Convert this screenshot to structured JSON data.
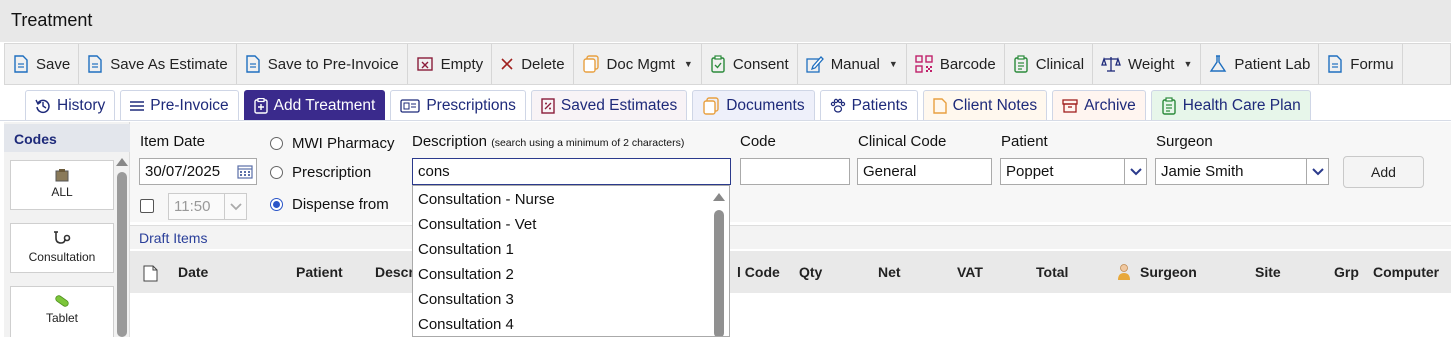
{
  "window": {
    "title": "Treatment"
  },
  "toolbar": [
    {
      "name": "save-button",
      "icon": "document-icon",
      "label": "Save",
      "caret": false
    },
    {
      "name": "save-as-estimate-button",
      "icon": "document-icon",
      "label": "Save As Estimate",
      "caret": false
    },
    {
      "name": "save-to-pre-invoice-button",
      "icon": "document-icon",
      "label": "Save to Pre-Invoice",
      "caret": false
    },
    {
      "name": "empty-button",
      "icon": "empty-box-icon",
      "label": "Empty",
      "caret": false
    },
    {
      "name": "delete-button",
      "icon": "close-icon",
      "label": "Delete",
      "caret": false
    },
    {
      "name": "doc-mgmt-button",
      "icon": "documents-icon",
      "label": "Doc Mgmt",
      "caret": true
    },
    {
      "name": "consent-button",
      "icon": "clipboard-check-icon",
      "label": "Consent",
      "caret": false
    },
    {
      "name": "manual-button",
      "icon": "pencil-icon",
      "label": "Manual",
      "caret": true
    },
    {
      "name": "barcode-button",
      "icon": "qr-code-icon",
      "label": "Barcode",
      "caret": false
    },
    {
      "name": "clinical-button",
      "icon": "clipboard-icon",
      "label": "Clinical",
      "caret": false
    },
    {
      "name": "weight-button",
      "icon": "scales-icon",
      "label": "Weight",
      "caret": true
    },
    {
      "name": "patient-lab-button",
      "icon": "flask-icon",
      "label": "Patient Lab",
      "caret": false
    },
    {
      "name": "formulary-button",
      "icon": "document-icon",
      "label": "Formu",
      "caret": false
    }
  ],
  "tabs": [
    {
      "name": "tab-history",
      "icon": "history-icon",
      "label": "History",
      "variant": ""
    },
    {
      "name": "tab-pre-invoice",
      "icon": "list-icon",
      "label": "Pre-Invoice",
      "variant": ""
    },
    {
      "name": "tab-add-treatment",
      "icon": "clipboard-plus-icon",
      "label": "Add Treatment",
      "variant": "active"
    },
    {
      "name": "tab-prescriptions",
      "icon": "prescription-icon",
      "label": "Prescriptions",
      "variant": ""
    },
    {
      "name": "tab-saved-estimates",
      "icon": "estimate-icon",
      "label": "Saved Estimates",
      "variant": "saved"
    },
    {
      "name": "tab-documents",
      "icon": "documents-icon",
      "label": "Documents",
      "variant": "docs"
    },
    {
      "name": "tab-patients",
      "icon": "paw-icon",
      "label": "Patients",
      "variant": ""
    },
    {
      "name": "tab-client-notes",
      "icon": "note-icon",
      "label": "Client Notes",
      "variant": "notes"
    },
    {
      "name": "tab-archive",
      "icon": "archive-icon",
      "label": "Archive",
      "variant": "archive"
    },
    {
      "name": "tab-health-care-plan",
      "icon": "clipboard-icon",
      "label": "Health Care Plan",
      "variant": "hcp"
    }
  ],
  "codes": {
    "heading": "Codes",
    "items": [
      {
        "name": "code-all",
        "icon": "box-icon",
        "label": "ALL"
      },
      {
        "name": "code-consultation",
        "icon": "stethoscope-icon",
        "label": "Consultation"
      },
      {
        "name": "code-tablet",
        "icon": "pill-icon",
        "label": "Tablet"
      }
    ]
  },
  "form": {
    "item_date_label": "Item Date",
    "item_date_value": "30/07/2025",
    "time_value": "11:50",
    "time_checked": false,
    "radios": [
      {
        "label": "MWI Pharmacy",
        "checked": false
      },
      {
        "label": "Prescription",
        "checked": false
      },
      {
        "label": "Dispense from",
        "checked": true
      }
    ],
    "description_label": "Description",
    "description_hint": "(search using a minimum of 2 characters)",
    "description_value": "cons",
    "code_label": "Code",
    "code_value": "",
    "clinical_code_label": "Clinical Code",
    "clinical_code_value": "General",
    "patient_label": "Patient",
    "patient_value": "Poppet",
    "surgeon_label": "Surgeon",
    "surgeon_value": "Jamie Smith",
    "add_label": "Add"
  },
  "suggestions": [
    "Consultation - Nurse",
    "Consultation - Vet",
    "Consultation 1",
    "Consultation 2",
    "Consultation 3",
    "Consultation 4"
  ],
  "draft": {
    "heading": "Draft Items",
    "columns": [
      "Date",
      "Patient",
      "Descri",
      "l Code",
      "Qty",
      "Net",
      "VAT",
      "Total",
      "Surgeon",
      "Site",
      "Grp",
      "Computer"
    ]
  }
}
